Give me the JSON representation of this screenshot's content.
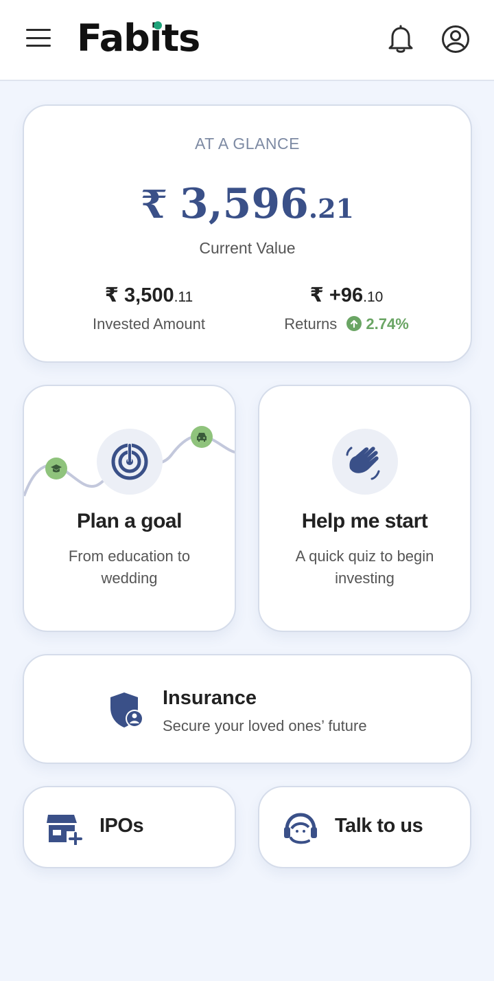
{
  "header": {
    "app_name": "Fabits",
    "icons": {
      "menu": "hamburger-menu-icon",
      "notifications": "bell-icon",
      "profile": "user-circle-icon"
    }
  },
  "glance": {
    "label": "AT A GLANCE",
    "current_value": {
      "currency": "₹",
      "whole": "3,596",
      "decimal": ".21",
      "label": "Current Value"
    },
    "invested": {
      "prefix": "₹ ",
      "whole": "3,500",
      "decimal": ".11",
      "label": "Invested Amount"
    },
    "returns": {
      "prefix": "₹ ",
      "whole": "+96",
      "decimal": ".10",
      "label": "Returns",
      "percent": "2.74%",
      "trend_icon": "arrow-up-circle-icon"
    }
  },
  "actions": {
    "plan_goal": {
      "title": "Plan a goal",
      "subtitle": "From education to wedding",
      "icons": [
        "target-icon",
        "graduation-cap-icon",
        "car-icon"
      ]
    },
    "help_start": {
      "title": "Help me start",
      "subtitle": "A quick quiz to begin investing",
      "icon": "waving-hand-icon"
    },
    "insurance": {
      "title": "Insurance",
      "subtitle": "Secure your loved ones’ future",
      "icon": "shield-user-icon"
    },
    "ipos": {
      "label": "IPOs",
      "icon": "store-add-icon"
    },
    "talk": {
      "label": "Talk to us",
      "icon": "support-agent-icon"
    }
  },
  "colors": {
    "brand_blue": "#3a5088",
    "accent_green": "#6aa564",
    "badge_green": "#8fc37c",
    "logo_dot": "#1fa37a",
    "page_bg": "#f1f5fd"
  }
}
